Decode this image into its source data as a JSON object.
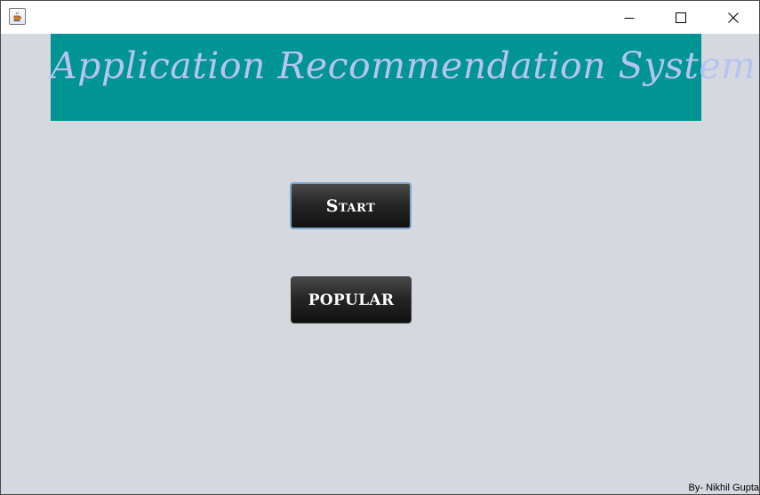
{
  "window": {
    "controls": {
      "minimize_icon": "minimize-icon",
      "maximize_icon": "maximize-icon",
      "close_icon": "close-icon"
    },
    "app_icon": "java-coffee-cup-icon"
  },
  "banner": {
    "title": "Application Recommendation System",
    "background_color": "#009494",
    "text_color": "#b7c4f2"
  },
  "buttons": {
    "start_label": "Start",
    "popular_label": "POPULAR"
  },
  "footer": {
    "credit": "By- Nikhil Gupta"
  },
  "colors": {
    "window_background": "#d5d8df",
    "button_background": "#1f1f1f",
    "button_focus_border": "#7ea6cc"
  }
}
